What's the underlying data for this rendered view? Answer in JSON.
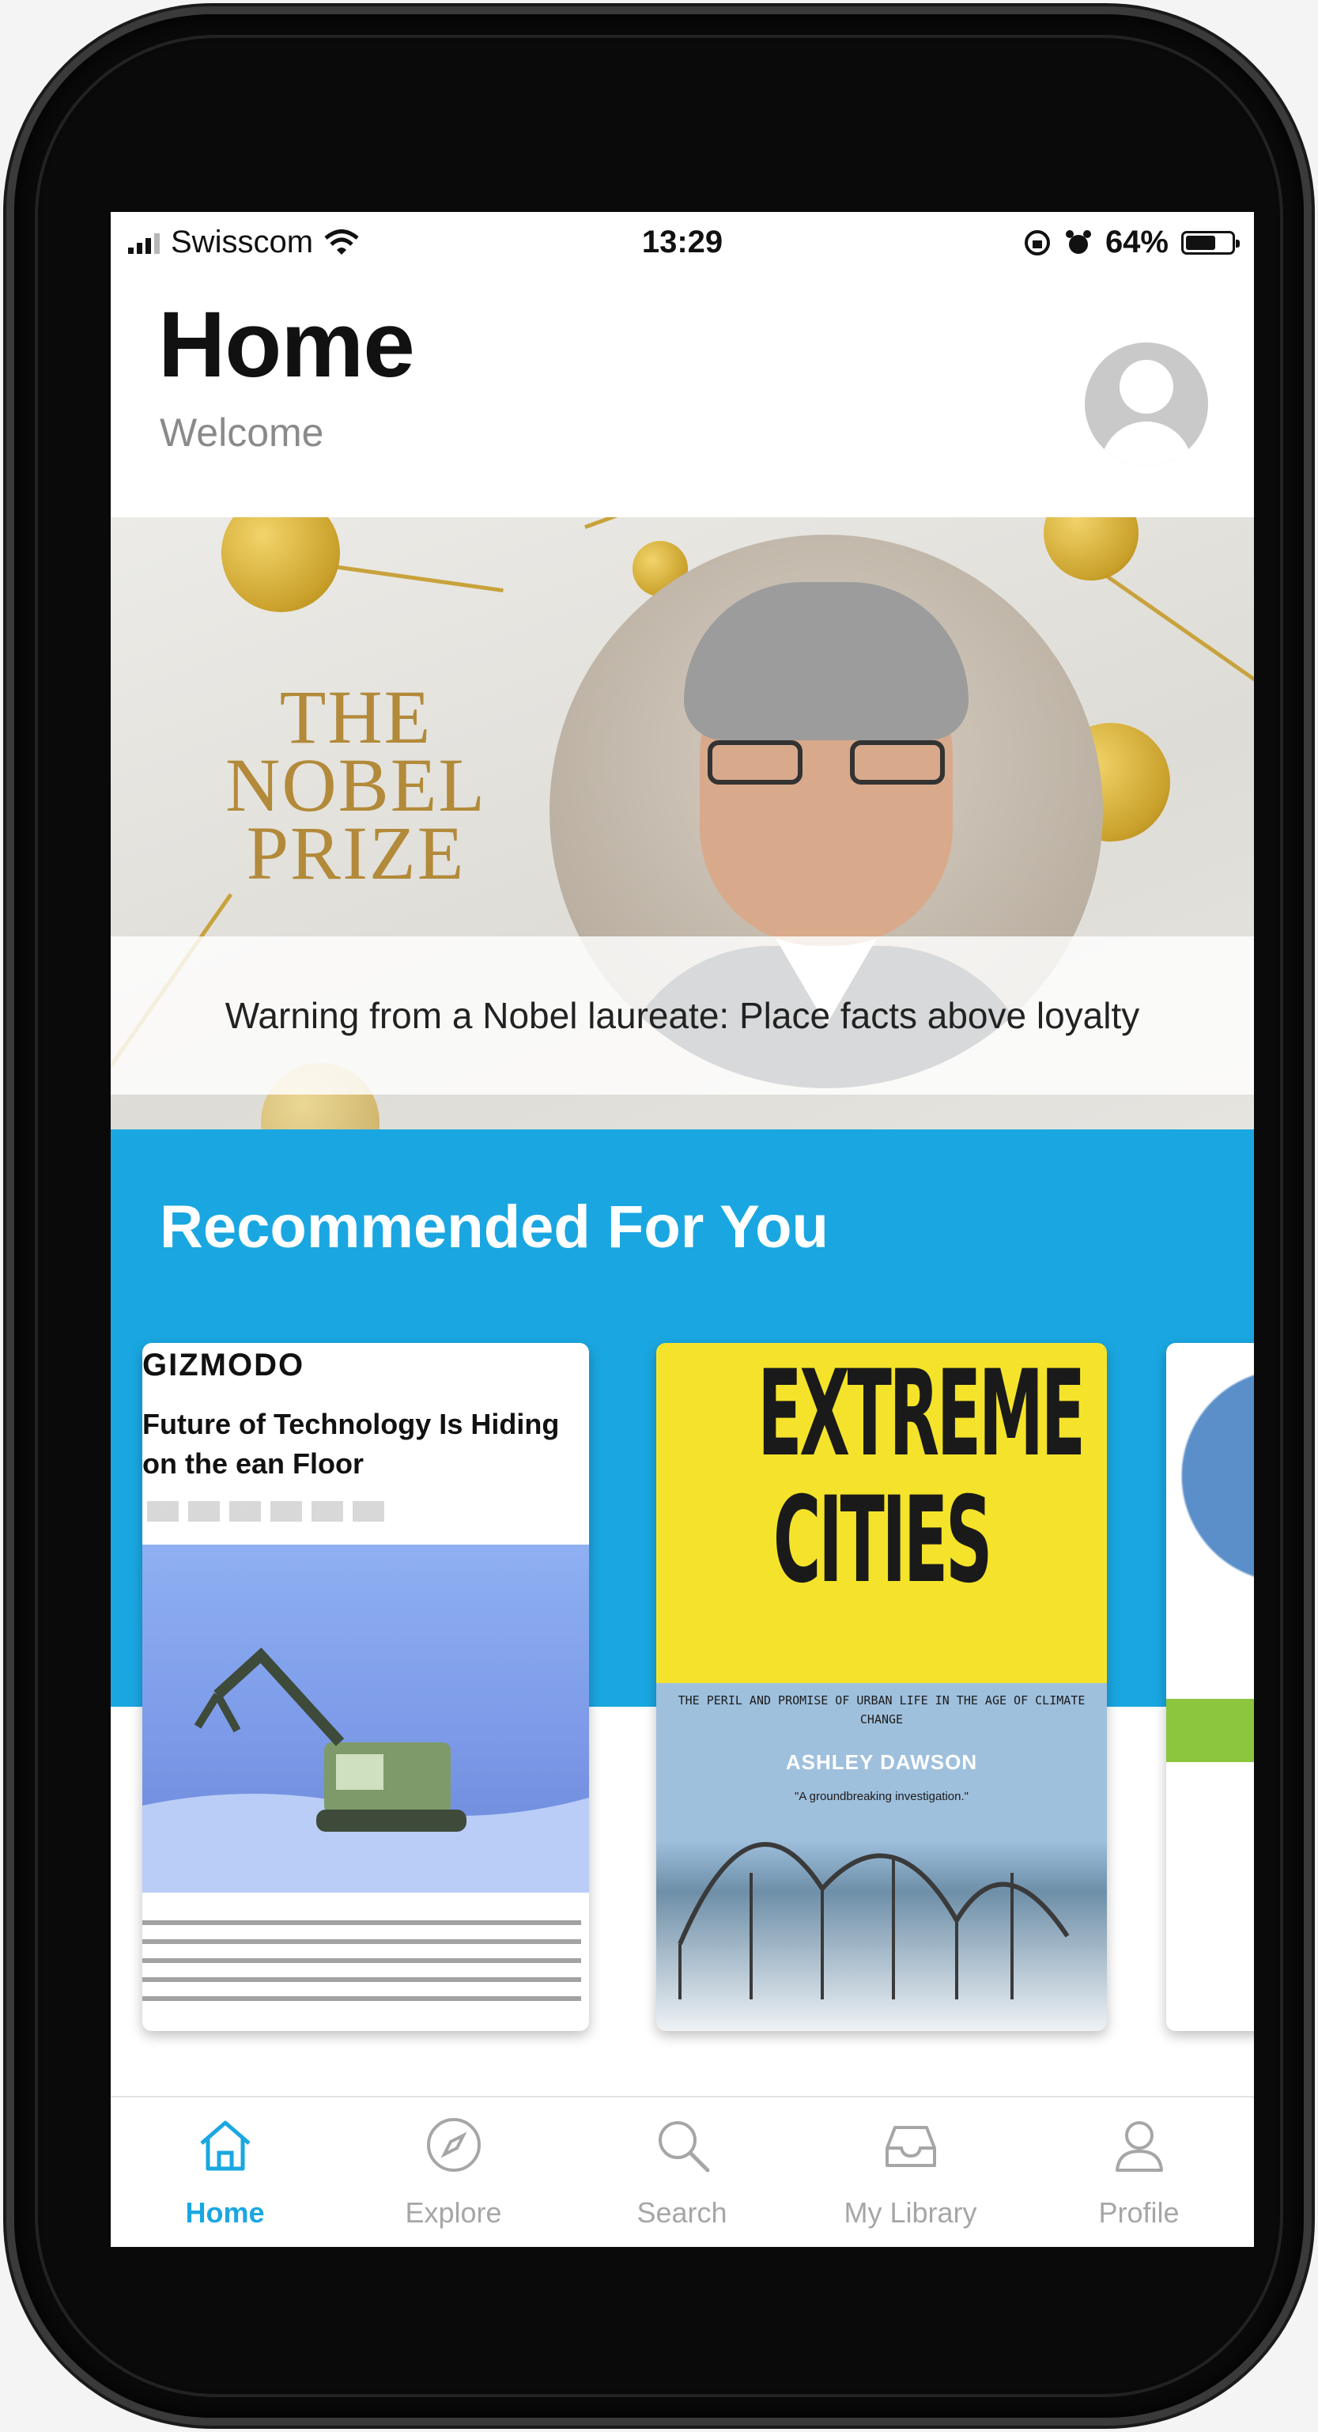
{
  "status_bar": {
    "carrier": "Swisscom",
    "time": "13:29",
    "battery": "64%"
  },
  "header": {
    "title": "Home",
    "subtitle": "Welcome"
  },
  "hero": {
    "logo_line1": "THE",
    "logo_line2": "NOBEL",
    "logo_line3": "PRIZE",
    "caption": "Warning from a Nobel laureate: Place facts above loyalty"
  },
  "recommended": {
    "heading": "Recommended For You",
    "cards": [
      {
        "brand": "GIZMODO",
        "headline": "Future of Technology Is Hiding on the ean Floor"
      },
      {
        "title_line1": "EXTREME",
        "title_line2": "CITIES",
        "subtitle": "THE PERIL AND PROMISE OF URBAN LIFE IN THE AGE OF CLIMATE CHANGE",
        "author": "ASHLEY DAWSON",
        "blurb": "\"A groundbreaking investigation.\""
      },
      {}
    ]
  },
  "tabbar": {
    "active": "Home",
    "items": [
      {
        "label": "Home",
        "icon": "home-icon"
      },
      {
        "label": "Explore",
        "icon": "compass-icon"
      },
      {
        "label": "Search",
        "icon": "search-icon"
      },
      {
        "label": "My Library",
        "icon": "library-icon"
      },
      {
        "label": "Profile",
        "icon": "profile-icon"
      }
    ]
  },
  "colors": {
    "accent": "#1aa7e1",
    "inactive_tab": "#a6a6a6",
    "nobel_gold": "#b28a3a",
    "book_yellow": "#f4e32a"
  }
}
